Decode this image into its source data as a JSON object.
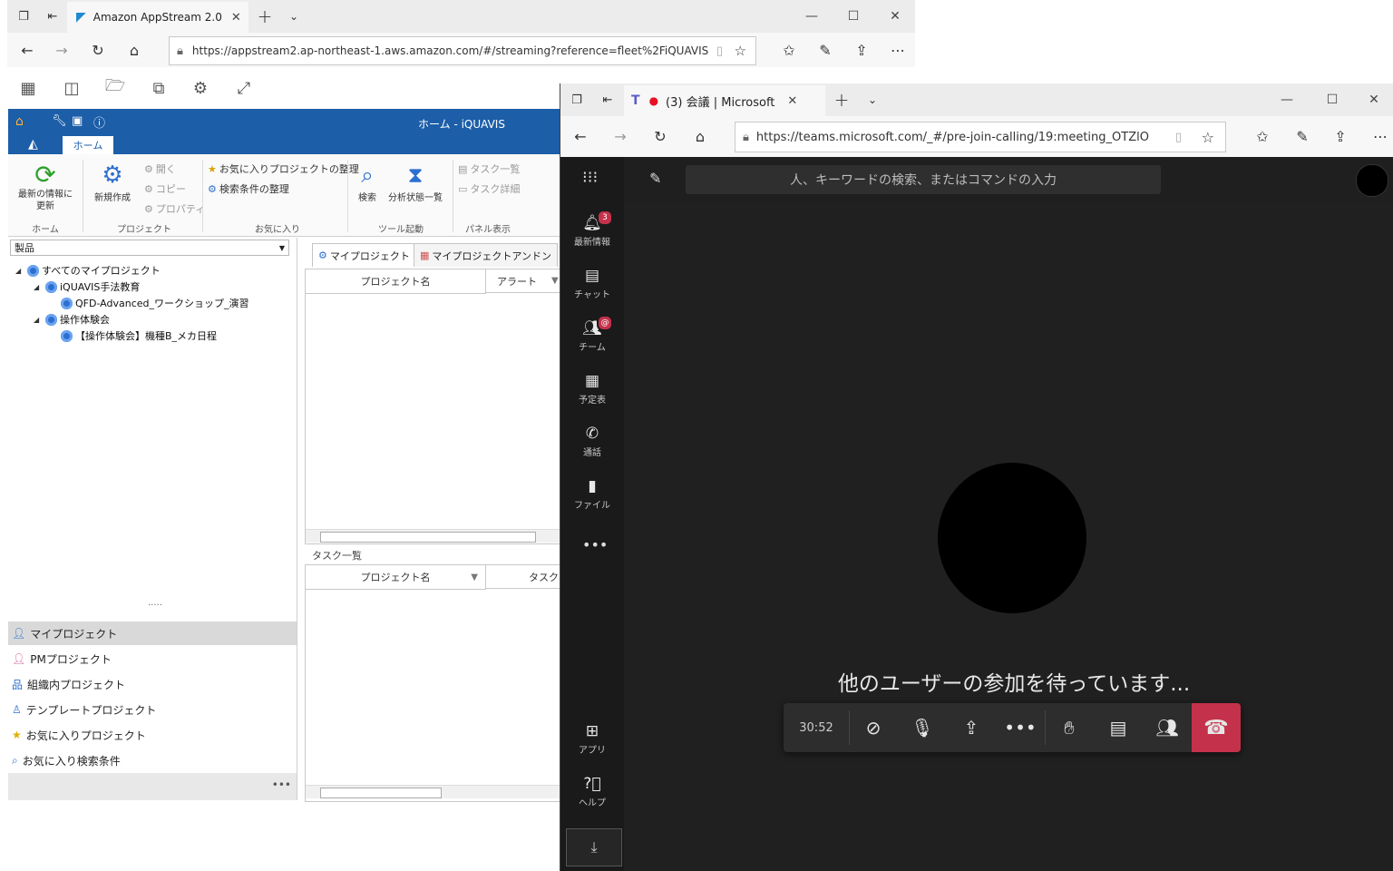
{
  "browser1": {
    "tab_title": "Amazon AppStream 2.0",
    "url": "https://appstream2.ap-northeast-1.aws.amazon.com/#/streaming?reference=fleet%2FiQUAVIS"
  },
  "iquavis": {
    "window_title": "ホーム - iQUAVIS",
    "home_tab": "ホーム",
    "ribbon": {
      "refresh": "最新の情報に\n更新",
      "new": "新規作成",
      "open": "開く",
      "copy": "コピー",
      "property": "プロパティ",
      "fav_projects": "お気に入りプロジェクトの整理",
      "search_conditions": "検索条件の整理",
      "search": "検索",
      "analysis": "分析状態一覧",
      "task_list": "タスク一覧",
      "task_detail": "タスク詳細",
      "groups": {
        "home": "ホーム",
        "project": "プロジェクト",
        "favorite": "お気に入り",
        "tool": "ツール起動",
        "panel": "パネル表示"
      }
    },
    "combo_value": "製品",
    "tree": {
      "root": "すべてのマイプロジェクト",
      "n1": "iQUAVIS手法教育",
      "n1a": "QFD-Advanced_ワークショップ_演習",
      "n2": "操作体験会",
      "n2a": "【操作体験会】機種B_メカ日程"
    },
    "nav": {
      "my": "マイプロジェクト",
      "pm": "PMプロジェクト",
      "org": "組織内プロジェクト",
      "template": "テンプレートプロジェクト",
      "fav": "お気に入りプロジェクト",
      "fav_search": "お気に入り検索条件"
    },
    "content_tabs": {
      "t1": "マイプロジェクト",
      "t2": "マイプロジェクトアンドン"
    },
    "grid1": {
      "col1": "プロジェクト名",
      "col2": "アラート"
    },
    "task_section": "タスク一覧",
    "grid2": {
      "col1": "プロジェクト名",
      "col2": "タスク"
    }
  },
  "browser2": {
    "tab_title": "(3) 会議 | Microsoft",
    "url": "https://teams.microsoft.com/_#/pre-join-calling/19:meeting_OTZlO"
  },
  "teams": {
    "search_placeholder": "人、キーワードの検索、またはコマンドの入力",
    "sidebar": {
      "activity": "最新情報",
      "chat": "チャット",
      "teams": "チーム",
      "calendar": "予定表",
      "calls": "通話",
      "files": "ファイル",
      "apps": "アプリ",
      "help": "ヘルプ"
    },
    "badges": {
      "activity": "3",
      "teams": "@"
    },
    "waiting_text": "他のユーザーの参加を待っています...",
    "call_timer": "30:52",
    "colors": {
      "hangup": "#c4314b",
      "accent_blue": "#1c5ea8"
    }
  }
}
